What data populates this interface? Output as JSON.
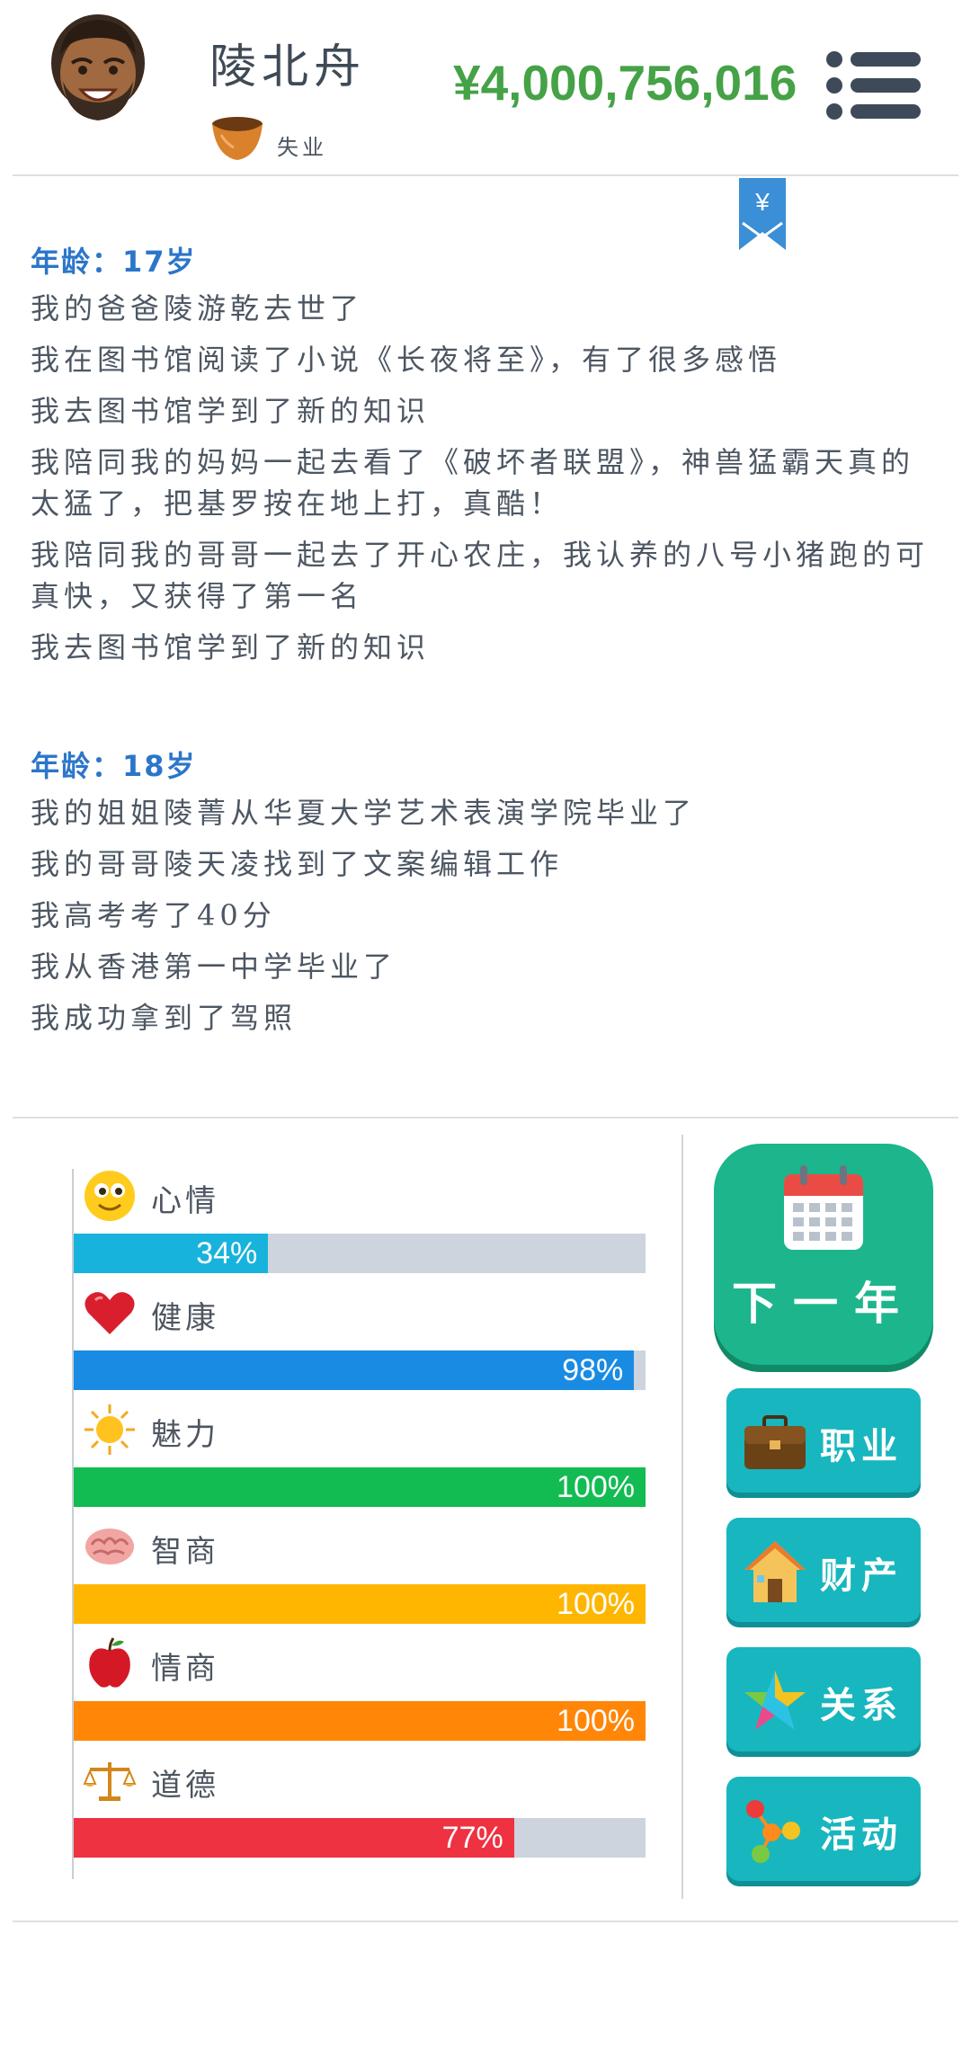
{
  "header": {
    "name": "陵北舟",
    "job": "失业",
    "money": "¥4,000,756,016",
    "ribbon_symbol": "¥"
  },
  "log": [
    {
      "age": "年龄：17岁",
      "events": [
        "我的爸爸陵游乾去世了",
        "我在图书馆阅读了小说《长夜将至》，有了很多感悟",
        "我去图书馆学到了新的知识",
        "我陪同我的妈妈一起去看了《破坏者联盟》，神兽猛霸天真的太猛了，把基罗按在地上打，真酷！",
        "我陪同我的哥哥一起去了开心农庄，我认养的八号小猪跑的可真快，又获得了第一名",
        "我去图书馆学到了新的知识"
      ]
    },
    {
      "age": "年龄：18岁",
      "events": [
        "我的姐姐陵菁从华夏大学艺术表演学院毕业了",
        "我的哥哥陵天凌找到了文案编辑工作",
        "我高考考了40分",
        "我从香港第一中学毕业了",
        "我成功拿到了驾照"
      ]
    }
  ],
  "stats": [
    {
      "label": "心情",
      "value": 34,
      "text": "34%",
      "color": "#17b3dd",
      "icon": "smiley-icon"
    },
    {
      "label": "健康",
      "value": 98,
      "text": "98%",
      "color": "#1a8be3",
      "icon": "heart-icon"
    },
    {
      "label": "魅力",
      "value": 100,
      "text": "100%",
      "color": "#12bc52",
      "icon": "sun-icon"
    },
    {
      "label": "智商",
      "value": 100,
      "text": "100%",
      "color": "#ffb600",
      "icon": "brain-icon"
    },
    {
      "label": "情商",
      "value": 100,
      "text": "100%",
      "color": "#ff8607",
      "icon": "apple-icon"
    },
    {
      "label": "道德",
      "value": 77,
      "text": "77%",
      "color": "#ee3242",
      "icon": "scales-icon"
    }
  ],
  "actions": {
    "next_year": "下一年",
    "career": "职业",
    "property": "财产",
    "relations": "关系",
    "activities": "活动"
  }
}
